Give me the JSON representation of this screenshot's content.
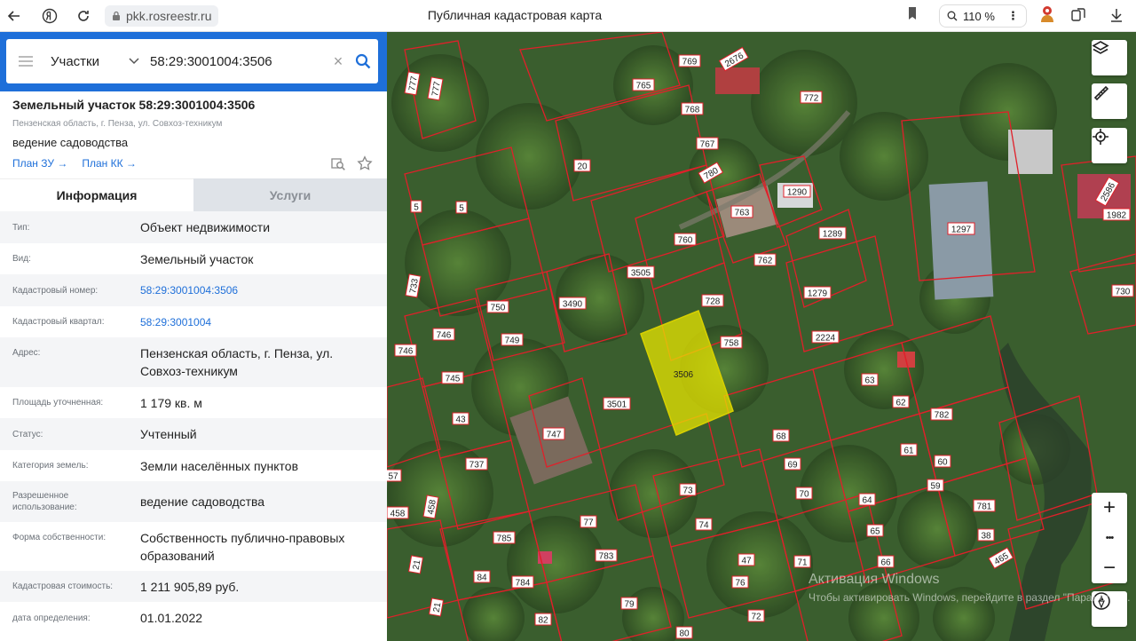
{
  "browser": {
    "url": "pkk.rosreestr.ru",
    "page_title": "Публичная кадастровая карта",
    "zoom": "110 %"
  },
  "search": {
    "type_label": "Участки",
    "query": "58:29:3001004:3506"
  },
  "parcel": {
    "title": "Земельный участок 58:29:3001004:3506",
    "address_short": "Пензенская область, г. Пенза, ул. Совхоз-техникум",
    "use": "ведение садоводства",
    "plan_zu": "План ЗУ →",
    "plan_kk": "План КК →"
  },
  "tabs": {
    "info": "Информация",
    "services": "Услуги"
  },
  "info_rows": [
    {
      "label": "Тип:",
      "value": "Объект недвижимости"
    },
    {
      "label": "Вид:",
      "value": "Земельный участок"
    },
    {
      "label": "Кадастровый номер:",
      "value": "58:29:3001004:3506",
      "link": true
    },
    {
      "label": "Кадастровый квартал:",
      "value": "58:29:3001004",
      "link": true
    },
    {
      "label": "Адрес:",
      "value": "Пензенская область, г. Пенза, ул. Совхоз-техникум"
    },
    {
      "label": "Площадь уточненная:",
      "value": "1 179 кв. м"
    },
    {
      "label": "Статус:",
      "value": "Учтенный"
    },
    {
      "label": "Категория земель:",
      "value": "Земли населённых пунктов"
    },
    {
      "label": "Разрешенное использование:",
      "value": "ведение садоводства"
    },
    {
      "label": "Форма собственности:",
      "value": "Собственность публично-правовых образований"
    },
    {
      "label": "Кадастровая стоимость:",
      "value": "1 211 905,89 руб."
    },
    {
      "label": "дата определения:",
      "value": "01.01.2022"
    }
  ],
  "map": {
    "selected_label": "3506",
    "parcel_labels": [
      "769",
      "2676",
      "777",
      "777",
      "765",
      "772",
      "768",
      "767",
      "20",
      "780",
      "1290",
      "5",
      "5",
      "763",
      "760",
      "1289",
      "1297",
      "2586",
      "1982",
      "1279",
      "762",
      "3505",
      "728",
      "730",
      "750",
      "3490",
      "733",
      "746",
      "749",
      "3506",
      "758",
      "2224",
      "746",
      "745",
      "3501",
      "63",
      "62",
      "782",
      "43",
      "747",
      "68",
      "61",
      "737",
      "69",
      "60",
      "57",
      "73",
      "70",
      "59",
      "458",
      "458",
      "77",
      "74",
      "64",
      "781",
      "785",
      "65",
      "38",
      "783",
      "47",
      "71",
      "66",
      "465",
      "21",
      "84",
      "784",
      "76",
      "79",
      "72",
      "21",
      "82",
      "80"
    ],
    "tool_icons": [
      "layers-icon",
      "ruler-icon",
      "locate-icon"
    ],
    "zoom_in": "+",
    "zoom_more": "•••",
    "zoom_out": "−",
    "watermark_line1": "Активация Windows",
    "watermark_line2": "Чтобы активировать Windows, перейдите в раздел \"Параметры\"."
  },
  "colors": {
    "brand_blue": "#1e6fd9",
    "selected_parcel": "#e8e600",
    "boundary": "#e0202a"
  }
}
